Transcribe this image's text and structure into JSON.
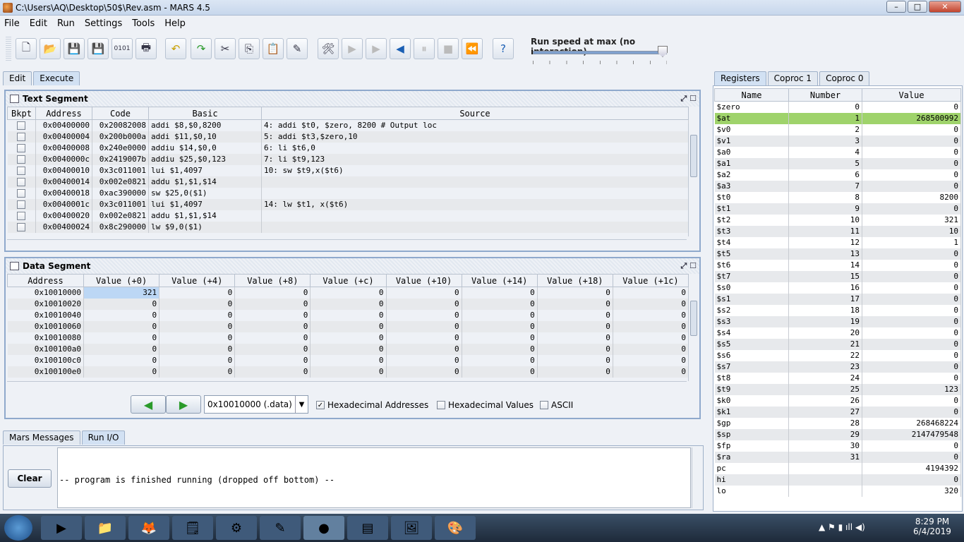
{
  "window": {
    "title": "C:\\Users\\AQ\\Desktop\\50$\\Rev.asm  - MARS 4.5",
    "minimize": "–",
    "maximize": "□",
    "close": "✕"
  },
  "menu": [
    "File",
    "Edit",
    "Run",
    "Settings",
    "Tools",
    "Help"
  ],
  "toolbar": {
    "speed_label": "Run speed at max (no interaction)",
    "speed_fraction": 0.95
  },
  "editor_tabs": {
    "edit": "Edit",
    "execute": "Execute"
  },
  "text_segment": {
    "title": "Text Segment",
    "headers": [
      "Bkpt",
      "Address",
      "Code",
      "Basic",
      "Source"
    ],
    "rows": [
      [
        "0x00400000",
        "0x20082008",
        "addi $8,$0,8200",
        "4: addi $t0, $zero, 8200 # Output loc"
      ],
      [
        "0x00400004",
        "0x200b000a",
        "addi $11,$0,10",
        "5: addi    $t3,$zero,10"
      ],
      [
        "0x00400008",
        "0x240e0000",
        "addiu $14,$0,0",
        "6: li $t6,0"
      ],
      [
        "0x0040000c",
        "0x2419007b",
        "addiu $25,$0,123",
        "7: li $t9,123"
      ],
      [
        "0x00400010",
        "0x3c011001",
        "lui $1,4097",
        "10: sw $t9,x($t6)"
      ],
      [
        "0x00400014",
        "0x002e0821",
        "addu $1,$1,$14",
        ""
      ],
      [
        "0x00400018",
        "0xac390000",
        "sw $25,0($1)",
        ""
      ],
      [
        "0x0040001c",
        "0x3c011001",
        "lui $1,4097",
        "14: lw $t1, x($t6)"
      ],
      [
        "0x00400020",
        "0x002e0821",
        "addu $1,$1,$14",
        ""
      ],
      [
        "0x00400024",
        "0x8c290000",
        "lw $9,0($1)",
        ""
      ]
    ]
  },
  "data_segment": {
    "title": "Data Segment",
    "headers": [
      "Address",
      "Value (+0)",
      "Value (+4)",
      "Value (+8)",
      "Value (+c)",
      "Value (+10)",
      "Value (+14)",
      "Value (+18)",
      "Value (+1c)"
    ],
    "rows": [
      [
        "0x10010000",
        "321",
        "0",
        "0",
        "0",
        "0",
        "0",
        "0",
        "0"
      ],
      [
        "0x10010020",
        "0",
        "0",
        "0",
        "0",
        "0",
        "0",
        "0",
        "0"
      ],
      [
        "0x10010040",
        "0",
        "0",
        "0",
        "0",
        "0",
        "0",
        "0",
        "0"
      ],
      [
        "0x10010060",
        "0",
        "0",
        "0",
        "0",
        "0",
        "0",
        "0",
        "0"
      ],
      [
        "0x10010080",
        "0",
        "0",
        "0",
        "0",
        "0",
        "0",
        "0",
        "0"
      ],
      [
        "0x100100a0",
        "0",
        "0",
        "0",
        "0",
        "0",
        "0",
        "0",
        "0"
      ],
      [
        "0x100100c0",
        "0",
        "0",
        "0",
        "0",
        "0",
        "0",
        "0",
        "0"
      ],
      [
        "0x100100e0",
        "0",
        "0",
        "0",
        "0",
        "0",
        "0",
        "0",
        "0"
      ]
    ],
    "region": "0x10010000 (.data)",
    "hex_addresses": "Hexadecimal Addresses",
    "hex_values": "Hexadecimal Values",
    "ascii": "ASCII",
    "prev": "◀",
    "next": "▶"
  },
  "messages": {
    "tab_mars": "Mars Messages",
    "tab_runio": "Run I/O",
    "clear": "Clear",
    "output": "-- program is finished running (dropped off bottom) --"
  },
  "registers": {
    "tabs": [
      "Registers",
      "Coproc 1",
      "Coproc 0"
    ],
    "headers": [
      "Name",
      "Number",
      "Value"
    ],
    "rows": [
      [
        "$zero",
        "0",
        "0"
      ],
      [
        "$at",
        "1",
        "268500992"
      ],
      [
        "$v0",
        "2",
        "0"
      ],
      [
        "$v1",
        "3",
        "0"
      ],
      [
        "$a0",
        "4",
        "0"
      ],
      [
        "$a1",
        "5",
        "0"
      ],
      [
        "$a2",
        "6",
        "0"
      ],
      [
        "$a3",
        "7",
        "0"
      ],
      [
        "$t0",
        "8",
        "8200"
      ],
      [
        "$t1",
        "9",
        "0"
      ],
      [
        "$t2",
        "10",
        "321"
      ],
      [
        "$t3",
        "11",
        "10"
      ],
      [
        "$t4",
        "12",
        "1"
      ],
      [
        "$t5",
        "13",
        "0"
      ],
      [
        "$t6",
        "14",
        "0"
      ],
      [
        "$t7",
        "15",
        "0"
      ],
      [
        "$s0",
        "16",
        "0"
      ],
      [
        "$s1",
        "17",
        "0"
      ],
      [
        "$s2",
        "18",
        "0"
      ],
      [
        "$s3",
        "19",
        "0"
      ],
      [
        "$s4",
        "20",
        "0"
      ],
      [
        "$s5",
        "21",
        "0"
      ],
      [
        "$s6",
        "22",
        "0"
      ],
      [
        "$s7",
        "23",
        "0"
      ],
      [
        "$t8",
        "24",
        "0"
      ],
      [
        "$t9",
        "25",
        "123"
      ],
      [
        "$k0",
        "26",
        "0"
      ],
      [
        "$k1",
        "27",
        "0"
      ],
      [
        "$gp",
        "28",
        "268468224"
      ],
      [
        "$sp",
        "29",
        "2147479548"
      ],
      [
        "$fp",
        "30",
        "0"
      ],
      [
        "$ra",
        "31",
        "0"
      ],
      [
        "pc",
        "",
        "4194392"
      ],
      [
        "hi",
        "",
        "0"
      ],
      [
        "lo",
        "",
        "320"
      ]
    ]
  },
  "taskbar": {
    "time": "8:29 PM",
    "date": "6/4/2019"
  }
}
